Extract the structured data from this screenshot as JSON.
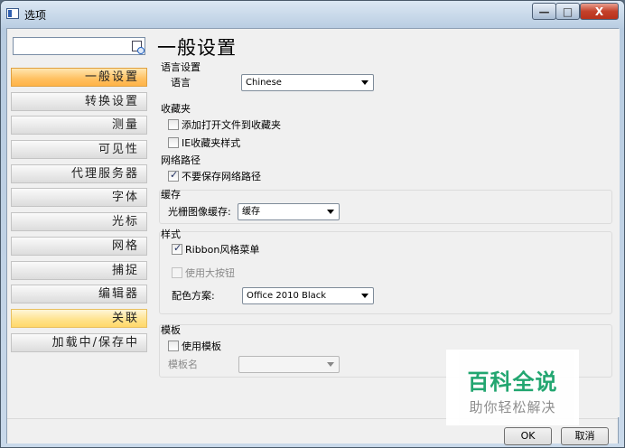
{
  "window": {
    "title": "选项",
    "controls": {
      "minimize": "—",
      "maximize": "□",
      "close": "X"
    }
  },
  "sidebar": {
    "search": {
      "value": "",
      "placeholder": ""
    },
    "items": [
      {
        "label": "一般设置",
        "state": "active"
      },
      {
        "label": "转换设置",
        "state": "normal"
      },
      {
        "label": "测量",
        "state": "normal"
      },
      {
        "label": "可见性",
        "state": "normal"
      },
      {
        "label": "代理服务器",
        "state": "normal"
      },
      {
        "label": "字体",
        "state": "normal"
      },
      {
        "label": "光标",
        "state": "normal"
      },
      {
        "label": "网格",
        "state": "normal"
      },
      {
        "label": "捕捉",
        "state": "normal"
      },
      {
        "label": "编辑器",
        "state": "normal"
      },
      {
        "label": "关联",
        "state": "hover"
      },
      {
        "label": "加载中/保存中",
        "state": "normal"
      }
    ]
  },
  "main": {
    "page_title": "一般设置",
    "language": {
      "group_title": "语言设置",
      "label": "语言",
      "value": "Chinese"
    },
    "favorites": {
      "group_title": "收藏夹",
      "add_to_favorites": {
        "label": "添加打开文件到收藏夹",
        "checked": false
      },
      "ie_style": {
        "label": "IE收藏夹样式",
        "checked": false
      }
    },
    "network": {
      "group_title": "网络路径",
      "dont_save": {
        "label": "不要保存网络路径",
        "checked": true
      }
    },
    "cache": {
      "group_title": "缓存",
      "label": "光栅图像缓存:",
      "value": "缓存"
    },
    "style": {
      "group_title": "样式",
      "ribbon": {
        "label": "Ribbon风格菜单",
        "checked": true
      },
      "big_buttons": {
        "label": "使用大按钮",
        "checked": false,
        "disabled": true
      },
      "color_scheme_label": "配色方案:",
      "color_scheme_value": "Office 2010 Black"
    },
    "template": {
      "group_title": "模板",
      "use_template": {
        "label": "使用模板",
        "checked": false
      },
      "template_name_label": "模板名",
      "template_name_value": ""
    }
  },
  "footer": {
    "ok_label": "OK",
    "cancel_label": "取消"
  },
  "watermark": {
    "title": "百科全说",
    "subtitle": "助你轻松解决"
  }
}
